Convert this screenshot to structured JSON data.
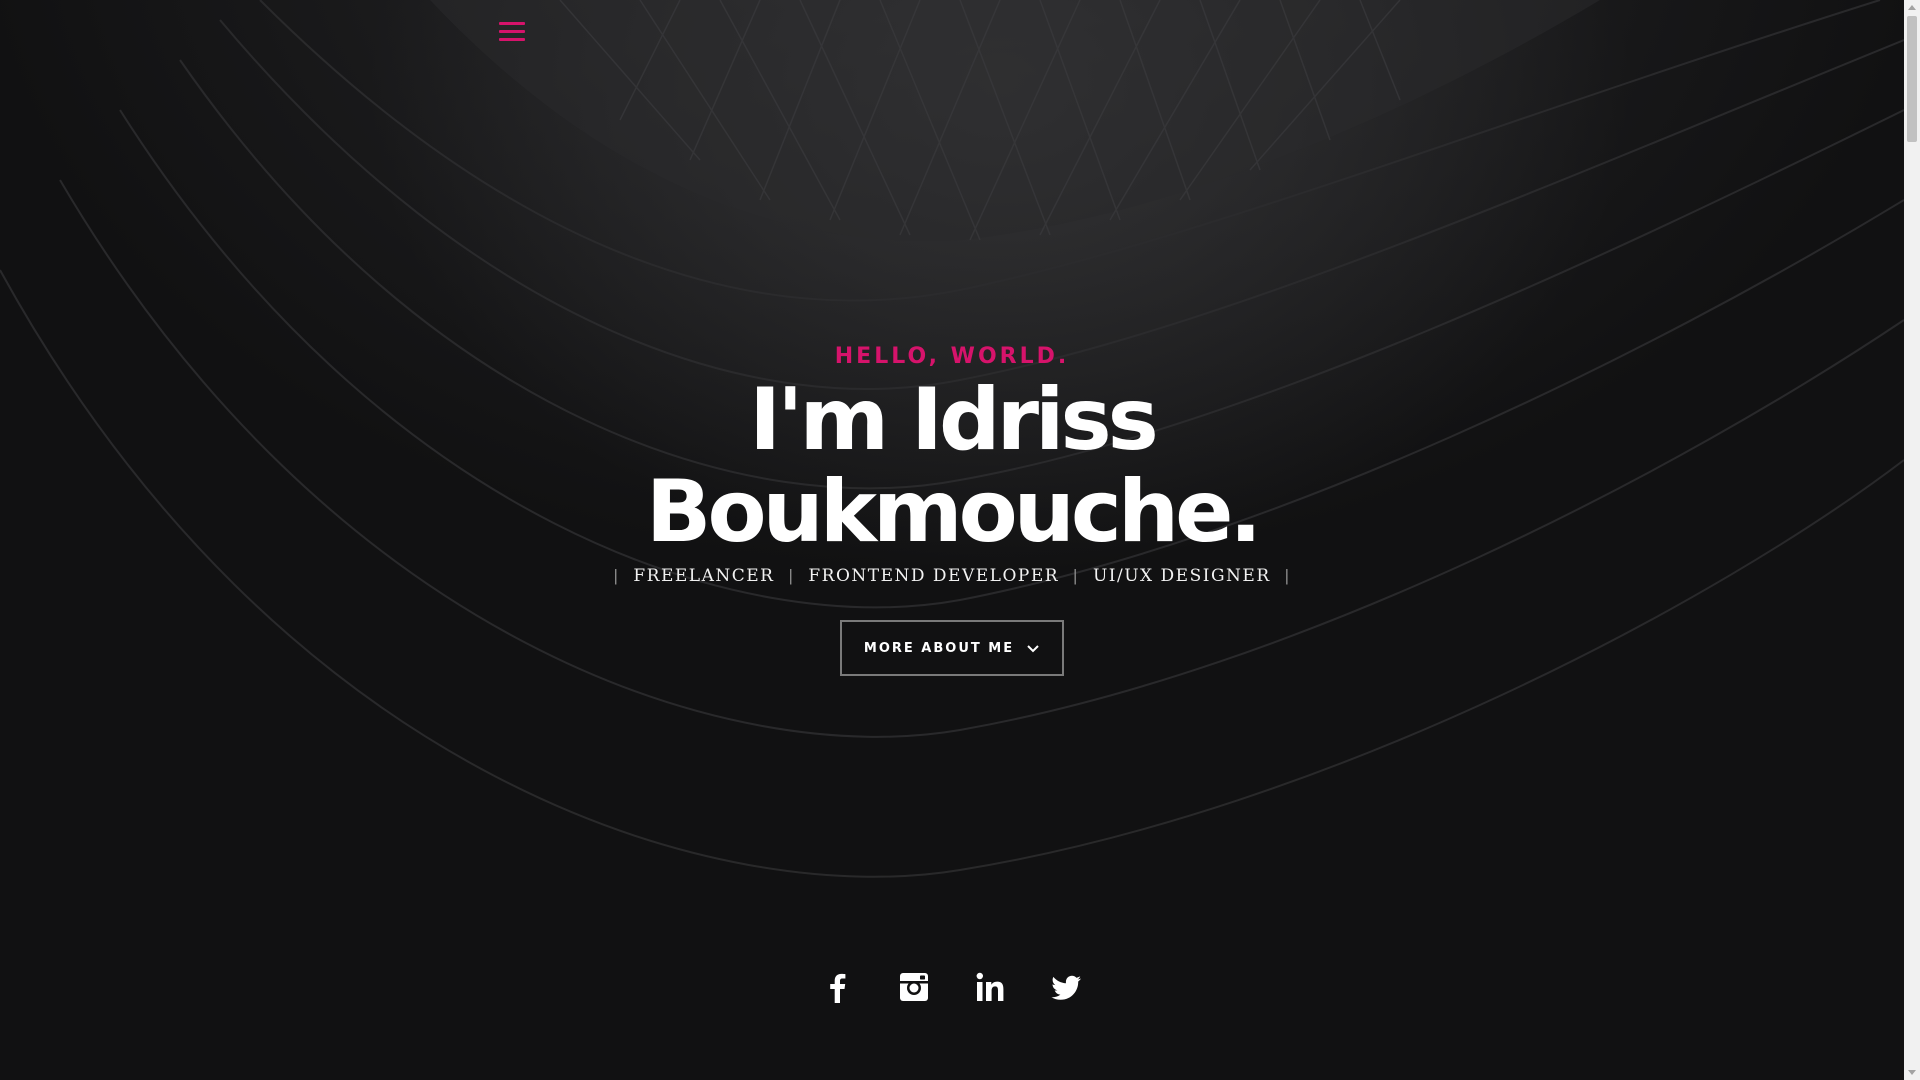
{
  "colors": {
    "accent": "#d6136b",
    "text": "#ffffff",
    "background": "#111112"
  },
  "nav": {
    "menu_icon": "hamburger-menu-icon"
  },
  "hero": {
    "greeting": "HELLO, WORLD.",
    "name_line1": "I'm Idriss",
    "name_line2": "Boukmouche.",
    "roles": [
      "FREELANCER",
      "FRONTEND DEVELOPER",
      "UI/UX DESIGNER"
    ],
    "cta_label": "MORE ABOUT ME",
    "cta_icon": "chevron-down-icon"
  },
  "social": [
    {
      "name": "facebook",
      "icon": "facebook-icon"
    },
    {
      "name": "instagram",
      "icon": "instagram-icon"
    },
    {
      "name": "linkedin",
      "icon": "linkedin-icon"
    },
    {
      "name": "twitter",
      "icon": "twitter-icon"
    }
  ]
}
